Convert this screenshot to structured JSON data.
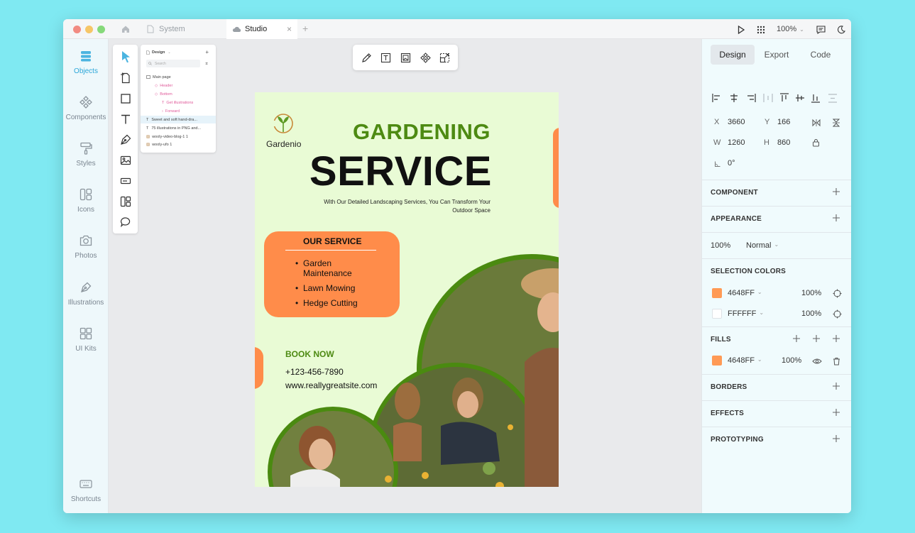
{
  "titlebar": {
    "tabs": [
      {
        "label": "System",
        "active": false
      },
      {
        "label": "Studio",
        "active": true
      }
    ],
    "zoom": "100%"
  },
  "leftbar": {
    "items": [
      {
        "label": "Objects",
        "icon": "objects-icon",
        "active": true
      },
      {
        "label": "Components",
        "icon": "components-icon"
      },
      {
        "label": "Styles",
        "icon": "styles-icon"
      },
      {
        "label": "Icons",
        "icon": "icons-icon"
      },
      {
        "label": "Photos",
        "icon": "photos-icon"
      },
      {
        "label": "Illustrations",
        "icon": "illustrations-icon"
      },
      {
        "label": "UI Kits",
        "icon": "ui-kits-icon"
      }
    ],
    "shortcuts": "Shortcuts"
  },
  "layers": {
    "title": "Design",
    "search_placeholder": "Search",
    "rows": [
      {
        "label": "Main page",
        "indent": 0
      },
      {
        "label": "Header",
        "indent": 1
      },
      {
        "label": "Bottom",
        "indent": 1
      },
      {
        "label": "Get illustrations",
        "indent": 2
      },
      {
        "label": "Forward",
        "indent": 2
      },
      {
        "label": "Sweet and soft  hand-dra...",
        "indent": 0
      },
      {
        "label": "75 illustrations in PNG and...",
        "indent": 0
      },
      {
        "label": "wooly-video-blog-1 1",
        "indent": 0
      },
      {
        "label": "wooly-ufo 1",
        "indent": 0
      }
    ]
  },
  "artboard": {
    "brand": "Gardenio",
    "title_line1": "GARDENING",
    "title_line2": "SERVICE",
    "subtitle_line1": "With Our Detailed Landscaping Services, You Can Transform Your",
    "subtitle_line2": "Outdoor Space",
    "service_heading": "OUR SERVICE",
    "services": [
      "Garden Maintenance",
      "Lawn Mowing",
      "Hedge Cutting"
    ],
    "book_now": "BOOK NOW",
    "phone": "+123-456-7890",
    "website": "www.reallygreatsite.com",
    "colors": {
      "background": "#e9fbd5",
      "accent": "#ff8c4a",
      "green": "#4a8a10",
      "title_green": "#4d8a12"
    }
  },
  "rightpanel": {
    "tabs": [
      "Design",
      "Export",
      "Code"
    ],
    "x_label": "X",
    "x_value": "3660",
    "y_label": "Y",
    "y_value": "166",
    "w_label": "W",
    "w_value": "1260",
    "h_label": "H",
    "h_value": "860",
    "rotation": "0°",
    "sections": {
      "component": "COMPONENT",
      "appearance": "APPEARANCE",
      "selection_colors": "SELECTION COLORS",
      "fills": "FILLS",
      "borders": "BORDERS",
      "effects": "EFFECTS",
      "prototyping": "PROTOTYPING"
    },
    "appearance": {
      "opacity": "100%",
      "blend": "Normal"
    },
    "selection_colors": [
      {
        "hex": "4648FF",
        "opacity": "100%",
        "swatch": "#ff9a55"
      },
      {
        "hex": "FFFFFF",
        "opacity": "100%",
        "swatch": "#ffffff"
      }
    ],
    "fill": {
      "hex": "4648FF",
      "opacity": "100%",
      "swatch": "#ff9a55"
    }
  }
}
